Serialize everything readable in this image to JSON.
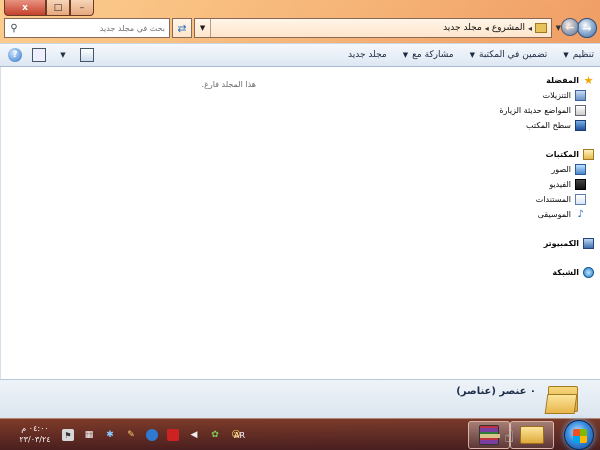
{
  "window": {
    "controls": {
      "close": "x",
      "maximize": "□",
      "minimize": "–"
    }
  },
  "address": {
    "breadcrumbs": [
      "المشروع",
      "مجلد جديد"
    ],
    "search_placeholder": "بحث في مجلد جديد"
  },
  "toolbar": {
    "organize": "تنظيم",
    "include_in_library": "تضمين في المكتبة",
    "share_with": "مشاركة مع",
    "new_folder": "مجلد جديد"
  },
  "content": {
    "empty_message": "هذا المجلد فارغ."
  },
  "nav": {
    "favorites": {
      "label": "المفضلة",
      "items": [
        {
          "label": "التنزيلات",
          "icon": "downloads-icon"
        },
        {
          "label": "المواضع حديثة الزيارة",
          "icon": "recent-places-icon"
        },
        {
          "label": "سطح المكتب",
          "icon": "desktop-icon"
        }
      ]
    },
    "libraries": {
      "label": "المكتبات",
      "items": [
        {
          "label": "الصور",
          "icon": "pictures-icon"
        },
        {
          "label": "الفيديو",
          "icon": "videos-icon"
        },
        {
          "label": "المستندات",
          "icon": "documents-icon"
        },
        {
          "label": "الموسيقى",
          "icon": "music-icon"
        }
      ]
    },
    "computer": {
      "label": "الكمبيوتر"
    },
    "network": {
      "label": "الشبكة"
    }
  },
  "details": {
    "item_count": "٠ عنصر (عناصر)"
  },
  "taskbar": {
    "language": "AR",
    "clock_time": "٠٤:٠٠ م",
    "clock_date": "٢٣/٠٣/٢٤"
  },
  "colors": {
    "accent": "#3a6aa8",
    "command_bar": "#dde7f2",
    "details_pane": "#dbe5ef",
    "taskbar": "#5a2a2a"
  }
}
